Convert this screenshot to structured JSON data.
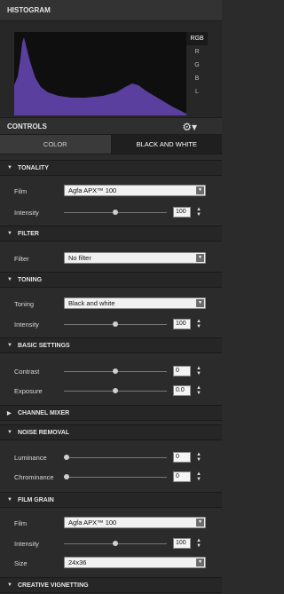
{
  "histogram": {
    "title": "HISTOGRAM",
    "channels": [
      "RGB",
      "R",
      "G",
      "B",
      "L"
    ],
    "selected_channel": "RGB",
    "fill_color": "#5a3f9e"
  },
  "controls": {
    "title": "CONTROLS",
    "gear_icon": "gear-icon",
    "tabs": [
      "COLOR",
      "BLACK AND WHITE"
    ],
    "active_tab": "BLACK AND WHITE"
  },
  "sections": {
    "tonality": {
      "title": "TONALITY",
      "film_label": "Film",
      "film_value": "Agfa APX™ 100",
      "intensity_label": "Intensity",
      "intensity_value": "100"
    },
    "filter": {
      "title": "FILTER",
      "filter_label": "Filter",
      "filter_value": "No filter"
    },
    "toning": {
      "title": "TONING",
      "toning_label": "Toning",
      "toning_value": "Black and white",
      "intensity_label": "Intensity",
      "intensity_value": "100"
    },
    "basic": {
      "title": "BASIC SETTINGS",
      "contrast_label": "Contrast",
      "contrast_value": "0",
      "exposure_label": "Exposure",
      "exposure_value": "0.0"
    },
    "channel_mixer": {
      "title": "CHANNEL MIXER"
    },
    "noise": {
      "title": "NOISE REMOVAL",
      "luminance_label": "Luminance",
      "luminance_value": "0",
      "chrominance_label": "Chrominance",
      "chrominance_value": "0"
    },
    "grain": {
      "title": "FILM GRAIN",
      "film_label": "Film",
      "film_value": "Agfa APX™ 100",
      "intensity_label": "Intensity",
      "intensity_value": "100",
      "size_label": "Size",
      "size_value": "24x36"
    },
    "vignetting": {
      "title": "CREATIVE VIGNETTING"
    }
  }
}
